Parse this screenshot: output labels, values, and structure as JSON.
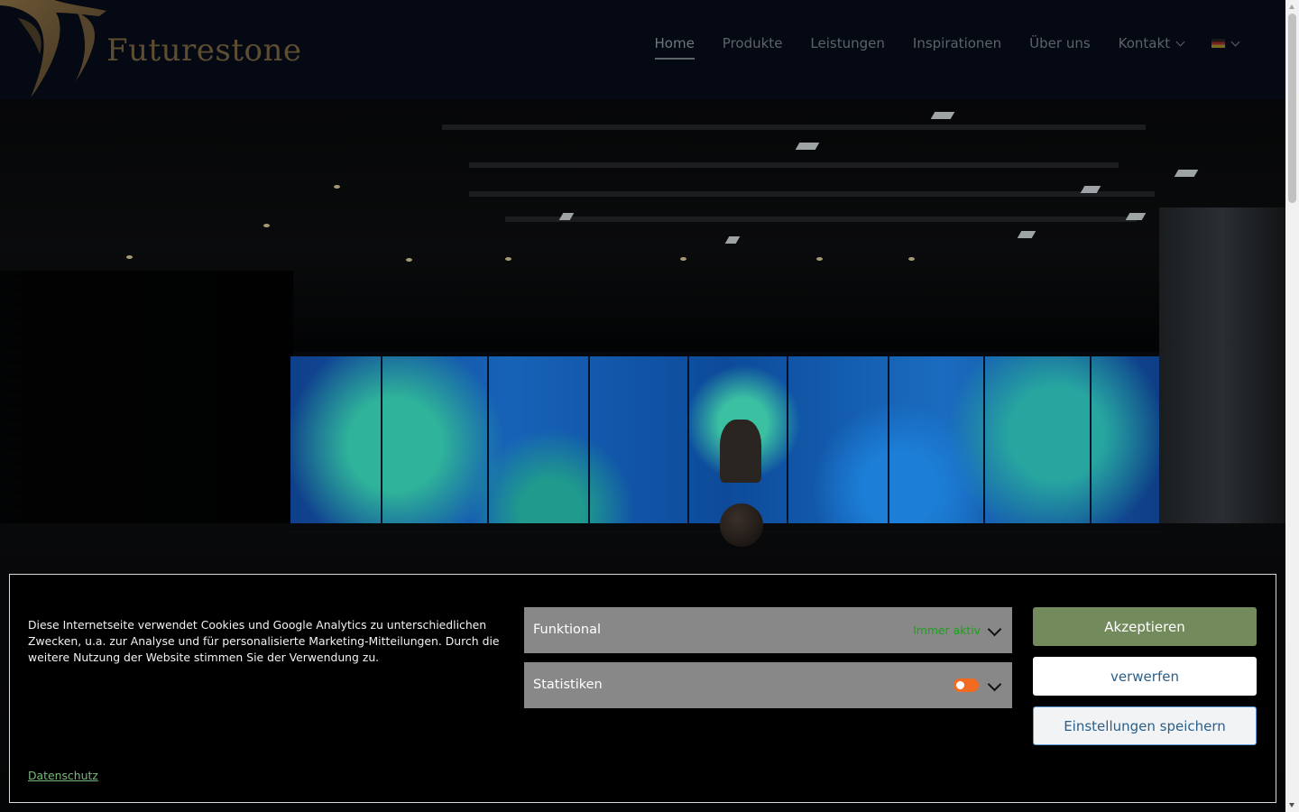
{
  "brand": {
    "name": "Futurestone"
  },
  "nav": {
    "items": [
      {
        "label": "Home",
        "active": true
      },
      {
        "label": "Produkte"
      },
      {
        "label": "Leistungen"
      },
      {
        "label": "Inspirationen"
      },
      {
        "label": "Über uns"
      },
      {
        "label": "Kontakt",
        "has_dropdown": true
      }
    ],
    "language": {
      "icon": "german-flag-icon",
      "has_dropdown": true
    }
  },
  "cookie_banner": {
    "text": "Diese Internetseite verwendet Cookies und Google Analytics zu unterschiedlichen Zwecken, u.a. zur Analyse und für personalisierte Marketing-Mitteilungen. Durch die weitere Nutzung der Website stimmen Sie der Verwendung zu.",
    "privacy_link": "Datenschutz",
    "categories": [
      {
        "label": "Funktional",
        "status": "Immer aktiv"
      },
      {
        "label": "Statistiken",
        "toggle": "off"
      }
    ],
    "buttons": {
      "accept": "Akzeptieren",
      "deny": "verwerfen",
      "save": "Einstellungen speichern"
    }
  },
  "colors": {
    "accept_button": "#738a5c",
    "always_active": "#1aa31a",
    "toggle": "#f26b21",
    "category_bg": "#888888",
    "logo_gold": "#5e4d31"
  }
}
